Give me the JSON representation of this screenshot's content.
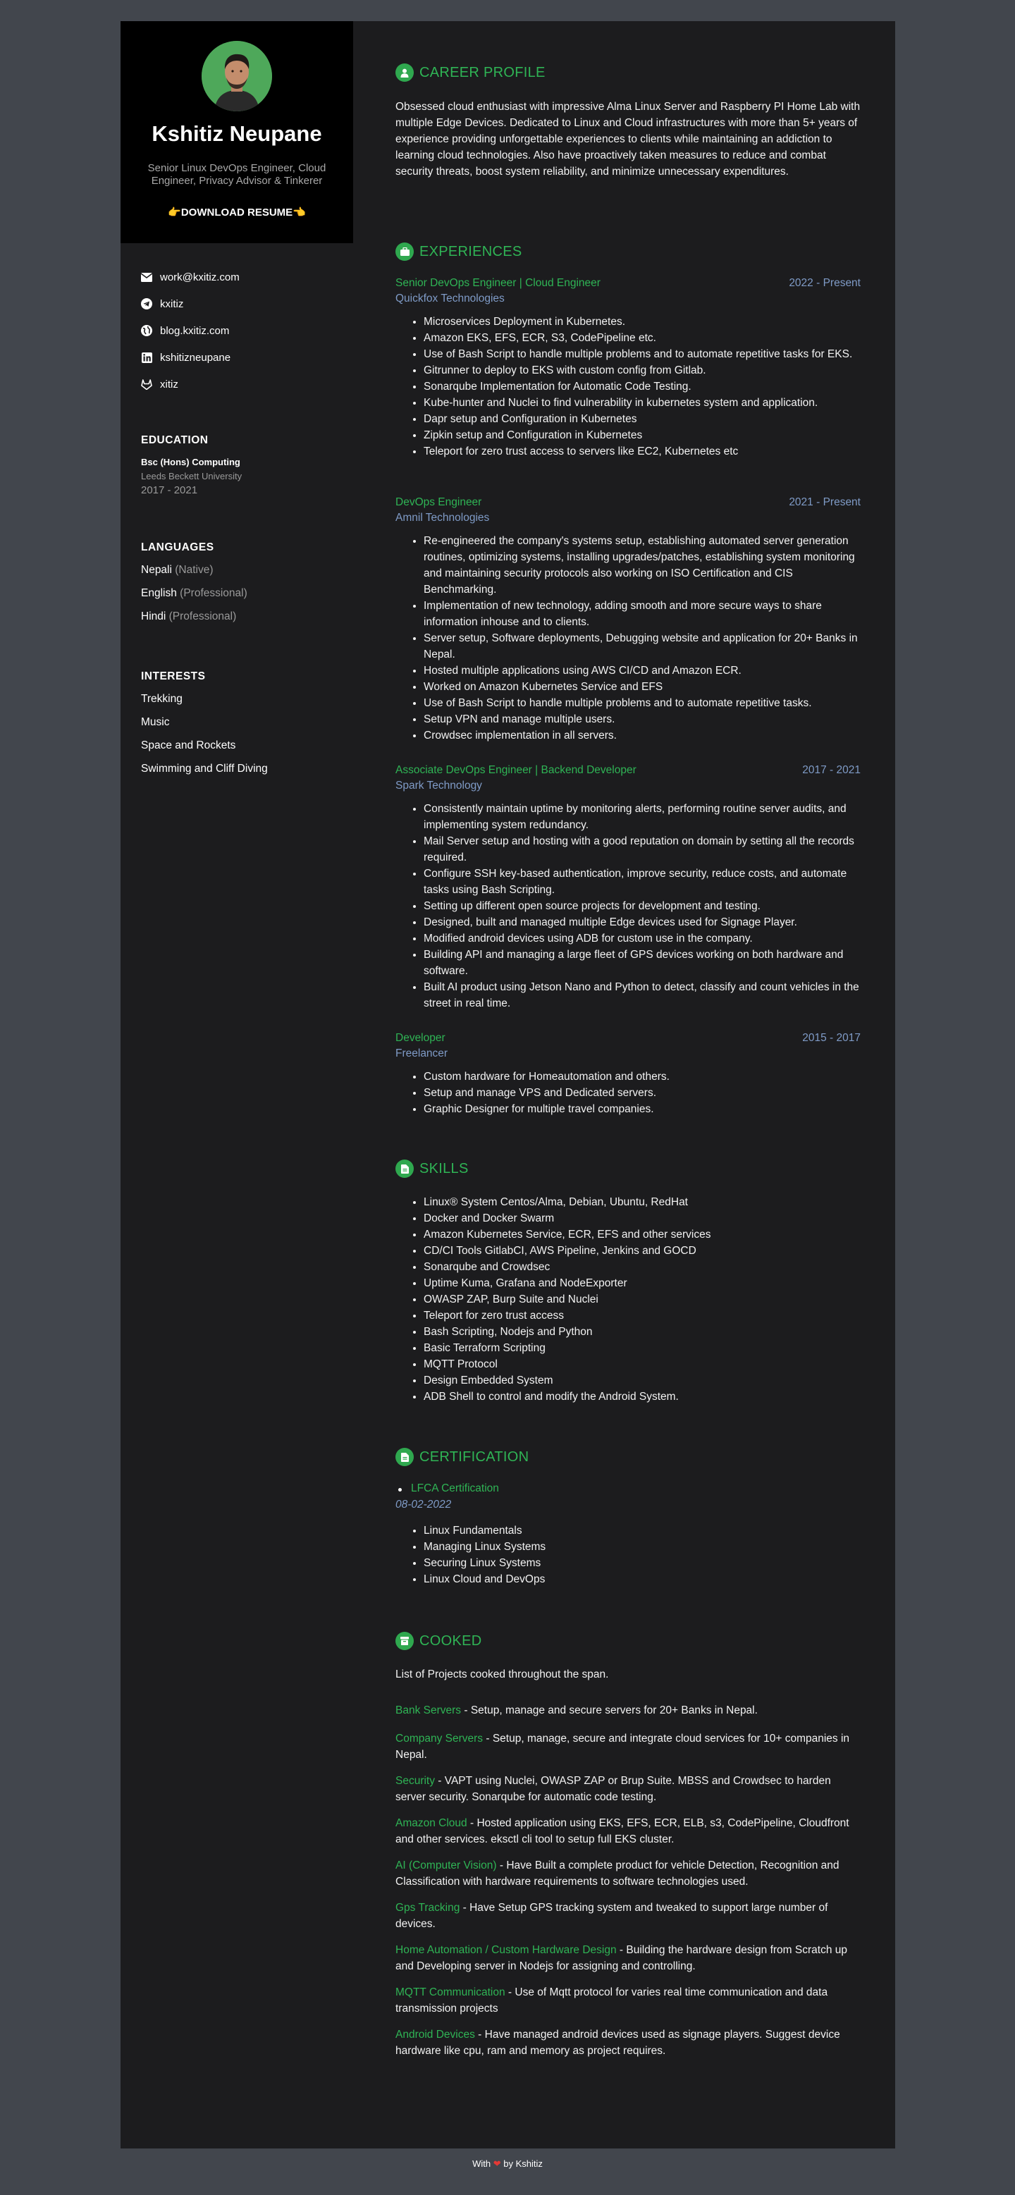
{
  "profile": {
    "name": "Kshitiz Neupane",
    "tagline": "Senior Linux DevOps Engineer, Cloud Engineer, Privacy Advisor & Tinkerer",
    "download": "👉DOWNLOAD RESUME👈"
  },
  "contacts": [
    {
      "icon": "envelope-icon",
      "text": "work@kxitiz.com"
    },
    {
      "icon": "telegram-icon",
      "text": "kxitiz"
    },
    {
      "icon": "globe-icon",
      "text": "blog.kxitiz.com"
    },
    {
      "icon": "linkedin-icon",
      "text": "kshitizneupane"
    },
    {
      "icon": "gitlab-icon",
      "text": "xitiz"
    }
  ],
  "education": {
    "title": "EDUCATION",
    "degree": "Bsc (Hons) Computing",
    "school": "Leeds Beckett University",
    "years": "2017 - 2021"
  },
  "languages": {
    "title": "LANGUAGES",
    "items": [
      {
        "name": "Nepali",
        "level": "(Native)"
      },
      {
        "name": "English",
        "level": "(Professional)"
      },
      {
        "name": "Hindi",
        "level": "(Professional)"
      }
    ]
  },
  "interests": {
    "title": "INTERESTS",
    "items": [
      "Trekking",
      "Music",
      "Space and Rockets",
      "Swimming and Cliff Diving"
    ]
  },
  "career": {
    "title": "CAREER PROFILE",
    "text": "Obsessed cloud enthusiast with impressive Alma Linux Server and Raspberry PI Home Lab with multiple Edge Devices. Dedicated to Linux and Cloud infrastructures with more than 5+ years of experience providing unforgettable experiences to clients while maintaining an addiction to learning cloud technologies. Also have proactively taken measures to reduce and combat security threats, boost system reliability, and minimize unnecessary expenditures."
  },
  "experiences": {
    "title": "EXPERIENCES",
    "jobs": [
      {
        "title": "Senior DevOps Engineer | Cloud Engineer",
        "date": "2022 - Present",
        "company": "Quickfox Technologies",
        "bullets": [
          "Microservices Deployment in Kubernetes.",
          "Amazon EKS, EFS, ECR, S3, CodePipeline etc.",
          "Use of Bash Script to handle multiple problems and to automate repetitive tasks for EKS.",
          "Gitrunner to deploy to EKS with custom config from Gitlab.",
          "Sonarqube Implementation for Automatic Code Testing.",
          "Kube-hunter and Nuclei to find vulnerability in kubernetes system and application.",
          "Dapr setup and Configuration in Kubernetes",
          "Zipkin setup and Configuration in Kubernetes",
          "Teleport for zero trust access to servers like EC2, Kubernetes etc"
        ]
      },
      {
        "title": "DevOps Engineer",
        "date": "2021 - Present",
        "company": "Amnil Technologies",
        "bullets": [
          "Re-engineered the company's systems setup, establishing automated server generation routines, optimizing systems, installing upgrades/patches, establishing system monitoring and maintaining security protocols also working on ISO Certification and CIS Benchmarking.",
          "Implementation of new technology, adding smooth and more secure ways to share information inhouse and to clients.",
          "Server setup, Software deployments, Debugging website and application for 20+ Banks in Nepal.",
          "Hosted multiple applications using AWS CI/CD and Amazon ECR.",
          "Worked on Amazon Kubernetes Service and EFS",
          "Use of Bash Script to handle multiple problems and to automate repetitive tasks.",
          "Setup VPN and manage multiple users.",
          "Crowdsec implementation in all servers."
        ]
      },
      {
        "title": "Associate DevOps Engineer | Backend Developer",
        "date": "2017 - 2021",
        "company": "Spark Technology",
        "bullets": [
          "Consistently maintain uptime by monitoring alerts, performing routine server audits, and implementing system redundancy.",
          "Mail Server setup and hosting with a good reputation on domain by setting all the records required.",
          "Configure SSH key-based authentication, improve security, reduce costs, and automate tasks using Bash Scripting.",
          "Setting up different open source projects for development and testing.",
          "Designed, built and managed multiple Edge devices used for Signage Player.",
          "Modified android devices using ADB for custom use in the company.",
          "Building API and managing a large fleet of GPS devices working on both hardware and software.",
          "Built AI product using Jetson Nano and Python to detect, classify and count vehicles in the street in real time."
        ]
      },
      {
        "title": "Developer",
        "date": "2015 - 2017",
        "company": "Freelancer",
        "bullets": [
          "Custom hardware for Homeautomation and others.",
          "Setup and manage VPS and Dedicated servers.",
          "Graphic Designer for multiple travel companies."
        ]
      }
    ]
  },
  "skills": {
    "title": "SKILLS",
    "items": [
      "Linux® System Centos/Alma, Debian, Ubuntu, RedHat",
      "Docker and Docker Swarm",
      "Amazon Kubernetes Service, ECR, EFS and other services",
      "CD/CI Tools GitlabCI, AWS Pipeline, Jenkins and GOCD",
      "Sonarqube and Crowdsec",
      "Uptime Kuma, Grafana and NodeExporter",
      "OWASP ZAP, Burp Suite and Nuclei",
      "Teleport for zero trust access",
      "Bash Scripting, Nodejs and Python",
      "Basic Terraform Scripting",
      "MQTT Protocol",
      "Design Embedded System",
      "ADB Shell to control and modify the Android System."
    ]
  },
  "certification": {
    "title": "CERTIFICATION",
    "name": "LFCA Certification",
    "date": "08-02-2022",
    "items": [
      "Linux Fundamentals",
      "Managing Linux Systems",
      "Securing Linux Systems",
      "Linux Cloud and DevOps"
    ]
  },
  "cooked": {
    "title": "COOKED",
    "intro": "List of Projects cooked throughout the span.",
    "projects": [
      {
        "name": "Bank Servers",
        "desc": " - Setup, manage and secure servers for 20+ Banks in Nepal."
      },
      {
        "name": "Company Servers",
        "desc": " - Setup, manage, secure and integrate cloud services for 10+ companies in Nepal."
      },
      {
        "name": "Security",
        "desc": " - VAPT using Nuclei, OWASP ZAP or Brup Suite. MBSS and Crowdsec to harden server security. Sonarqube for automatic code testing."
      },
      {
        "name": "Amazon Cloud",
        "desc": " - Hosted application using EKS, EFS, ECR, ELB, s3, CodePipeline, Cloudfront and other services. eksctl cli tool to setup full EKS cluster."
      },
      {
        "name": "AI (Computer Vision)",
        "desc": " - Have Built a complete product for vehicle Detection, Recognition and Classification with hardware requirements to software technologies used."
      },
      {
        "name": "Gps Tracking",
        "desc": " - Have Setup GPS tracking system and tweaked to support large number of devices."
      },
      {
        "name": "Home Automation / Custom Hardware Design",
        "desc": " - Building the hardware design from Scratch up and Developing server in Nodejs for assigning and controlling."
      },
      {
        "name": "MQTT Communication",
        "desc": " - Use of Mqtt protocol for varies real time communication and data transmission projects"
      },
      {
        "name": "Android Devices",
        "desc": " - Have managed android devices used as signage players. Suggest device hardware like cpu, ram and memory as project requires."
      }
    ]
  },
  "footer": {
    "prefix": "With",
    "heart": "❤",
    "suffix": "by Kshitiz"
  },
  "colors": {
    "accent": "#2fb455",
    "secondary": "#7f9bc7",
    "page_bg": "#42464d",
    "card_bg": "#1c1c1e",
    "sidebar_header_bg": "#000000"
  }
}
